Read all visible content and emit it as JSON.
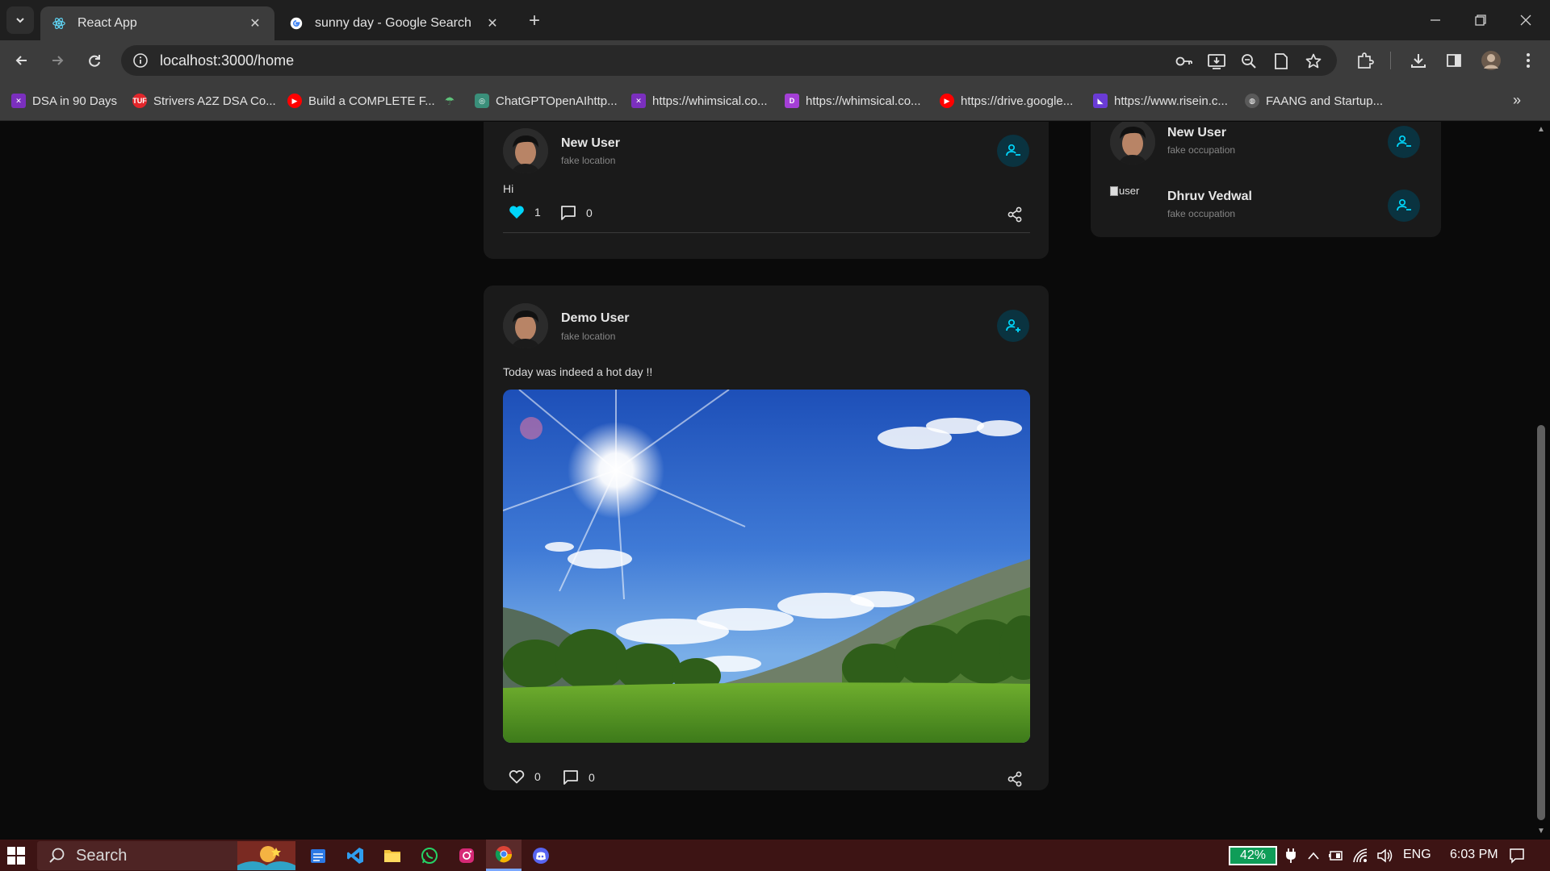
{
  "browser": {
    "tabs": [
      {
        "title": "React App",
        "active": true
      },
      {
        "title": "sunny day - Google Search",
        "active": false
      }
    ],
    "url": "localhost:3000/home",
    "bookmarks": [
      {
        "label": "DSA in 90 Days",
        "icon": "whimsical-icon"
      },
      {
        "label": "Strivers A2Z DSA Co...",
        "icon": "tuf-icon"
      },
      {
        "label": "Build a COMPLETE F...",
        "icon": "youtube-icon"
      },
      {
        "label": "",
        "icon": "umbrella-icon"
      },
      {
        "label": "ChatGPTOpenAIhttp...",
        "icon": "openai-icon"
      },
      {
        "label": "https://whimsical.co...",
        "icon": "whimsical-icon"
      },
      {
        "label": "https://whimsical.co...",
        "icon": "purple-d-icon"
      },
      {
        "label": "https://drive.google...",
        "icon": "youtube-icon"
      },
      {
        "label": "https://www.risein.c...",
        "icon": "risein-icon"
      },
      {
        "label": "FAANG and Startup...",
        "icon": "globe-icon"
      }
    ]
  },
  "posts": [
    {
      "user": "New User",
      "location": "fake location",
      "text": "Hi",
      "likes": "1",
      "comments": "0",
      "liked": true
    },
    {
      "user": "Demo User",
      "location": "fake location",
      "text": "Today was indeed a hot day !!",
      "likes": "0",
      "comments": "0",
      "liked": false
    }
  ],
  "friends": [
    {
      "name": "New User",
      "occupation": "fake occupation"
    },
    {
      "name": "Dhruv Vedwal",
      "occupation": "fake occupation",
      "broken_img_alt": "user"
    }
  ],
  "taskbar": {
    "search_placeholder": "Search",
    "battery": "42%",
    "language": "ENG",
    "time": "6:03 PM"
  },
  "colors": {
    "accent": "#00d5fa",
    "add_button_bg": "#0a3340",
    "card_bg": "#1a1a1a",
    "page_bg": "#0a0a0a"
  }
}
